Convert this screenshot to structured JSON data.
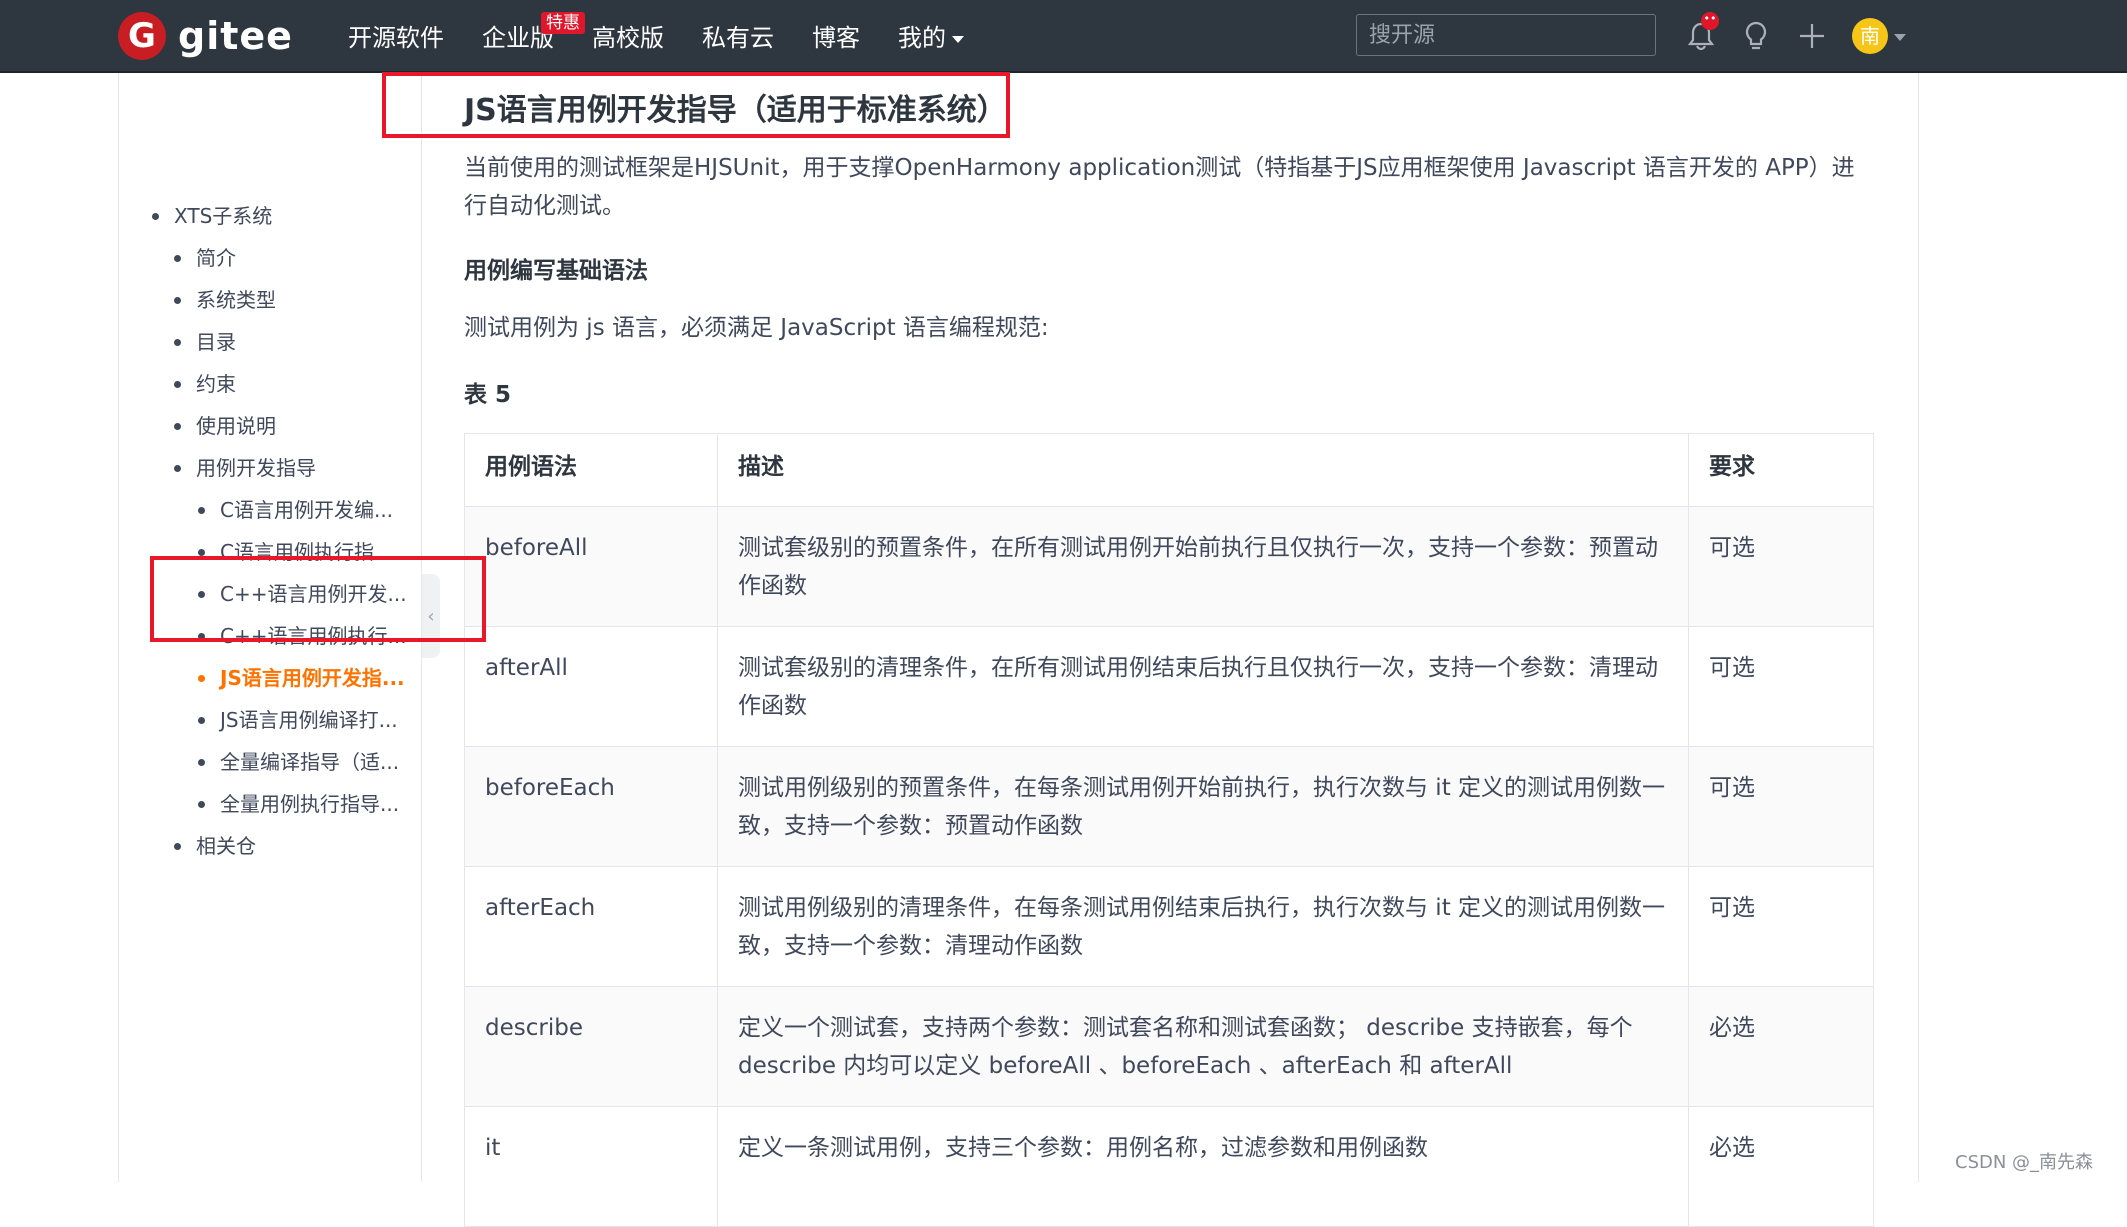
{
  "header": {
    "logo_mark": "G",
    "logo_text": "gitee",
    "nav": [
      {
        "label": "开源软件"
      },
      {
        "label": "企业版",
        "badge": "特惠"
      },
      {
        "label": "高校版"
      },
      {
        "label": "私有云"
      },
      {
        "label": "博客"
      },
      {
        "label": "我的"
      }
    ],
    "search_placeholder": "搜开源",
    "notification_badge": "••",
    "avatar_text": "南"
  },
  "sidebar": {
    "items": [
      {
        "label": "XTS子系统",
        "level": 0
      },
      {
        "label": "简介",
        "level": 1
      },
      {
        "label": "系统类型",
        "level": 1
      },
      {
        "label": "目录",
        "level": 1
      },
      {
        "label": "约束",
        "level": 1
      },
      {
        "label": "使用说明",
        "level": 1
      },
      {
        "label": "用例开发指导",
        "level": 1
      },
      {
        "label": "C语言用例开发编...",
        "level": 2
      },
      {
        "label": "C语言用例执行指...",
        "level": 2
      },
      {
        "label": "C++语言用例开发...",
        "level": 2
      },
      {
        "label": "C++语言用例执行...",
        "level": 2
      },
      {
        "label": "JS语言用例开发指...",
        "level": 2,
        "active": true
      },
      {
        "label": "JS语言用例编译打...",
        "level": 2
      },
      {
        "label": "全量编译指导（适...",
        "level": 2
      },
      {
        "label": "全量用例执行指导...",
        "level": 2
      },
      {
        "label": "相关仓",
        "level": 1
      }
    ],
    "collapse_glyph": "‹"
  },
  "content": {
    "title": "JS语言用例开发指导（适用于标准系统）",
    "intro": "当前使用的测试框架是HJSUnit，用于支撑OpenHarmony application测试（特指基于JS应用框架使用 Javascript 语言开发的 APP）进行自动化测试。",
    "subheading": "用例编写基础语法",
    "syntax_note": "测试用例为 js 语言，必须满足 JavaScript 语言编程规范:",
    "table_caption": "表 5",
    "table": {
      "headers": [
        "用例语法",
        "描述",
        "要求"
      ],
      "rows": [
        [
          "beforeAll",
          "测试套级别的预置条件，在所有测试用例开始前执行且仅执行一次，支持一个参数：预置动作函数",
          "可选"
        ],
        [
          "afterAll",
          "测试套级别的清理条件，在所有测试用例结束后执行且仅执行一次，支持一个参数：清理动作函数",
          "可选"
        ],
        [
          "beforeEach",
          "测试用例级别的预置条件，在每条测试用例开始前执行，执行次数与 it 定义的测试用例数一致，支持一个参数：预置动作函数",
          "可选"
        ],
        [
          "afterEach",
          "测试用例级别的清理条件，在每条测试用例结束后执行，执行次数与 it 定义的测试用例数一致，支持一个参数：清理动作函数",
          "可选"
        ],
        [
          "describe",
          "定义一个测试套，支持两个参数：测试套名称和测试套函数； describe 支持嵌套，每个 describe 内均可以定义 beforeAll 、beforeEach 、afterEach 和 afterAll",
          "必选"
        ],
        [
          "it",
          "定义一条测试用例，支持三个参数：用例名称，过滤参数和用例函数",
          "必选"
        ]
      ]
    }
  },
  "watermark": "CSDN @_南先森",
  "colors": {
    "topbar": "#2e3640",
    "brand_red": "#c71d23",
    "active_link": "#fe7300",
    "highlight_box": "#e8172a"
  }
}
